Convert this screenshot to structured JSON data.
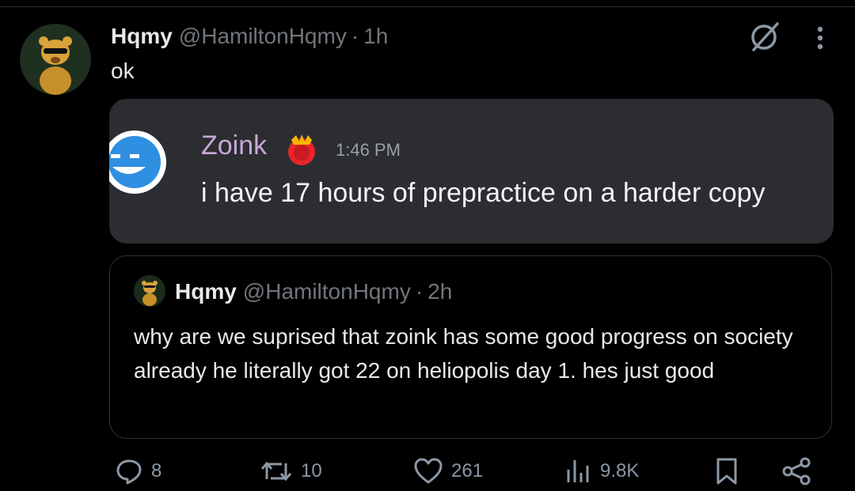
{
  "tweet": {
    "author_name": "Hqmy",
    "handle": "@HamiltonHqmy",
    "separator": "·",
    "time": "1h",
    "text": "ok"
  },
  "media": {
    "username": "Zoink",
    "timestamp": "1:46 PM",
    "message": "i have 17 hours of prepractice on a harder copy",
    "username_color": "#c9a8d9"
  },
  "quoted": {
    "author_name": "Hqmy",
    "handle": "@HamiltonHqmy",
    "separator": "·",
    "time": "2h",
    "text": "why are we suprised that zoink has some good progress on society already he literally got 22 on heliopolis day 1. hes just good"
  },
  "actions": {
    "replies": "8",
    "reposts": "10",
    "likes": "261",
    "views": "9.8K"
  },
  "icons": [
    "grok-icon",
    "more-icon",
    "reply-icon",
    "repost-icon",
    "like-icon",
    "views-icon",
    "bookmark-icon",
    "share-icon"
  ],
  "colors": {
    "background": "#000000",
    "text": "#e7e9ea",
    "secondary": "#71767b",
    "media_bg": "#2b2d31"
  }
}
